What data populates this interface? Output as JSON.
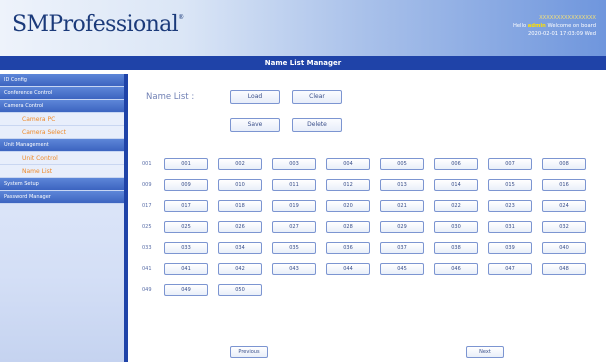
{
  "header": {
    "logo_text": "SMProfessional",
    "logo_mark": "®",
    "info_line1": "XXXXXXXXXXXXXXXX",
    "info_hello": "Hello",
    "info_user": "admin",
    "info_welcome": "Welcome on board",
    "info_datetime": "2020-02-01 17:03:09 Wed"
  },
  "title": "Name List Manager",
  "sidebar": {
    "items": [
      {
        "label": "ID Config",
        "type": "section"
      },
      {
        "label": "Conference Control",
        "type": "section"
      },
      {
        "label": "Camera Control",
        "type": "section"
      },
      {
        "label": "Camera PC",
        "type": "sub"
      },
      {
        "label": "Camera Select",
        "type": "sub"
      },
      {
        "label": "Unit Management",
        "type": "section"
      },
      {
        "label": "Unit Control",
        "type": "sub"
      },
      {
        "label": "Name List",
        "type": "sub"
      },
      {
        "label": "System Setup",
        "type": "section"
      },
      {
        "label": "Password Manager",
        "type": "section"
      }
    ]
  },
  "main": {
    "name_list_label": "Name List :",
    "load_label": "Load",
    "clear_label": "Clear",
    "save_label": "Save",
    "delete_label": "Delete",
    "rows": [
      {
        "label": "001",
        "slots": [
          "001",
          "002",
          "003",
          "004",
          "005",
          "006",
          "007",
          "008"
        ]
      },
      {
        "label": "009",
        "slots": [
          "009",
          "010",
          "011",
          "012",
          "013",
          "014",
          "015",
          "016"
        ]
      },
      {
        "label": "017",
        "slots": [
          "017",
          "018",
          "019",
          "020",
          "021",
          "022",
          "023",
          "024"
        ]
      },
      {
        "label": "025",
        "slots": [
          "025",
          "026",
          "027",
          "028",
          "029",
          "030",
          "031",
          "032"
        ]
      },
      {
        "label": "033",
        "slots": [
          "033",
          "034",
          "035",
          "036",
          "037",
          "038",
          "039",
          "040"
        ]
      },
      {
        "label": "041",
        "slots": [
          "041",
          "042",
          "043",
          "044",
          "045",
          "046",
          "047",
          "048"
        ]
      },
      {
        "label": "049",
        "slots": [
          "049",
          "050"
        ]
      }
    ],
    "previous_label": "Previous",
    "next_label": "Next"
  }
}
